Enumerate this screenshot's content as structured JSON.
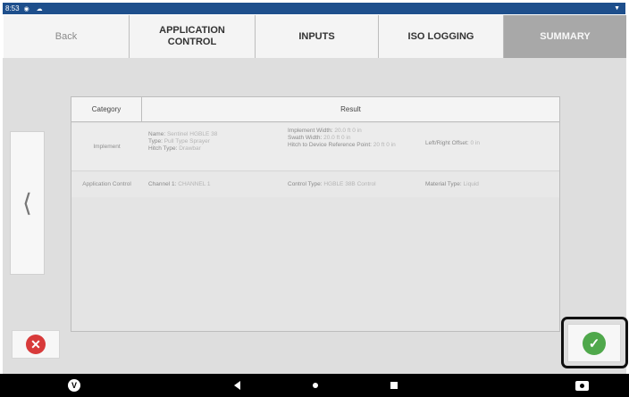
{
  "status_bar": {
    "time": "8:53"
  },
  "tabs": [
    {
      "label": "Back"
    },
    {
      "label": "APPLICATION\nCONTROL"
    },
    {
      "label": "INPUTS"
    },
    {
      "label": "ISO LOGGING"
    },
    {
      "label": "SUMMARY"
    }
  ],
  "table": {
    "headers": {
      "category": "Category",
      "result": "Result"
    },
    "rows": [
      {
        "category": "Implement",
        "col1": [
          {
            "label": "Name:",
            "value": "Sentinel HGBLE 38"
          },
          {
            "label": "Type:",
            "value": "Pull Type Sprayer"
          },
          {
            "label": "Hitch Type:",
            "value": "Drawbar"
          }
        ],
        "col2": [
          {
            "label": "Implement Width:",
            "value": "20.0 ft 0 in"
          },
          {
            "label": "Swath Width:",
            "value": "20.0 ft 0 in"
          },
          {
            "label": "Hitch to Device Reference Point:",
            "value": "20 ft 0 in"
          }
        ],
        "col3": [
          {
            "label": "Left/Right Offset:",
            "value": "0 in"
          }
        ]
      },
      {
        "category": "Application Control",
        "col1": [
          {
            "label": "Channel 1:",
            "value": "CHANNEL 1"
          }
        ],
        "col2": [
          {
            "label": "Control Type:",
            "value": "HGBLE 38B Control"
          }
        ],
        "col3": [
          {
            "label": "Material Type:",
            "value": "Liquid"
          }
        ]
      }
    ]
  },
  "icons": {
    "prev": "chevron-left-icon",
    "cancel": "close-icon",
    "confirm": "check-icon",
    "nav_logo": "v-logo-icon",
    "nav_back": "nav-back-icon",
    "nav_home": "nav-home-icon",
    "nav_recent": "nav-recents-icon",
    "camera": "camera-icon"
  },
  "colors": {
    "status_bar": "#1e4f8c",
    "active_tab": "#a8a8a8",
    "cancel": "#d83a3a",
    "confirm": "#4fa84b"
  }
}
